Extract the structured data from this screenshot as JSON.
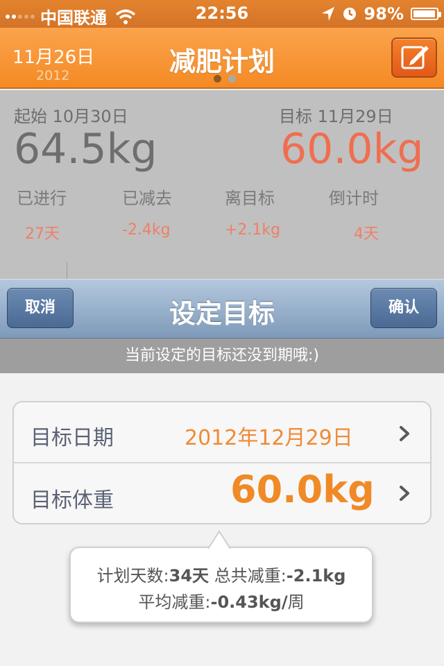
{
  "status_bar": {
    "carrier": "中国联通",
    "time": "22:56",
    "battery": "98%",
    "battery_level": 0.98
  },
  "navbar": {
    "date": "11月26日",
    "year": "2012",
    "title": "减肥计划",
    "page_count": 2,
    "active_page": 1
  },
  "summary": {
    "start_label": "起始 10月30日",
    "start_weight": "64.5kg",
    "target_label": "目标 11月29日",
    "target_weight": "60.0kg",
    "stats": [
      {
        "label": "已进行",
        "value": "27天"
      },
      {
        "label": "已减去",
        "value": "-2.4kg"
      },
      {
        "label": "离目标",
        "value": "+2.1kg"
      },
      {
        "label": "倒计时",
        "value": "4天"
      }
    ]
  },
  "dialog": {
    "title": "设定目标",
    "cancel_label": "取消",
    "confirm_label": "确认",
    "notice": "当前设定的目标还没到期哦:)"
  },
  "form": {
    "date_label": "目标日期",
    "date_value": "2012年12月29日",
    "weight_label": "目标体重",
    "weight_value": "60.0kg"
  },
  "bubble": {
    "days_label": "计划天数:",
    "days_value": "34天",
    "total_label": "总共减重:",
    "total_value": "-2.1kg",
    "avg_label": "平均减重:",
    "avg_value": "-0.43kg/",
    "avg_unit": "周"
  },
  "colors": {
    "accent_orange": "#f48a24",
    "target_red": "#f06e50",
    "dialog_blue": "#7e9ab9"
  }
}
